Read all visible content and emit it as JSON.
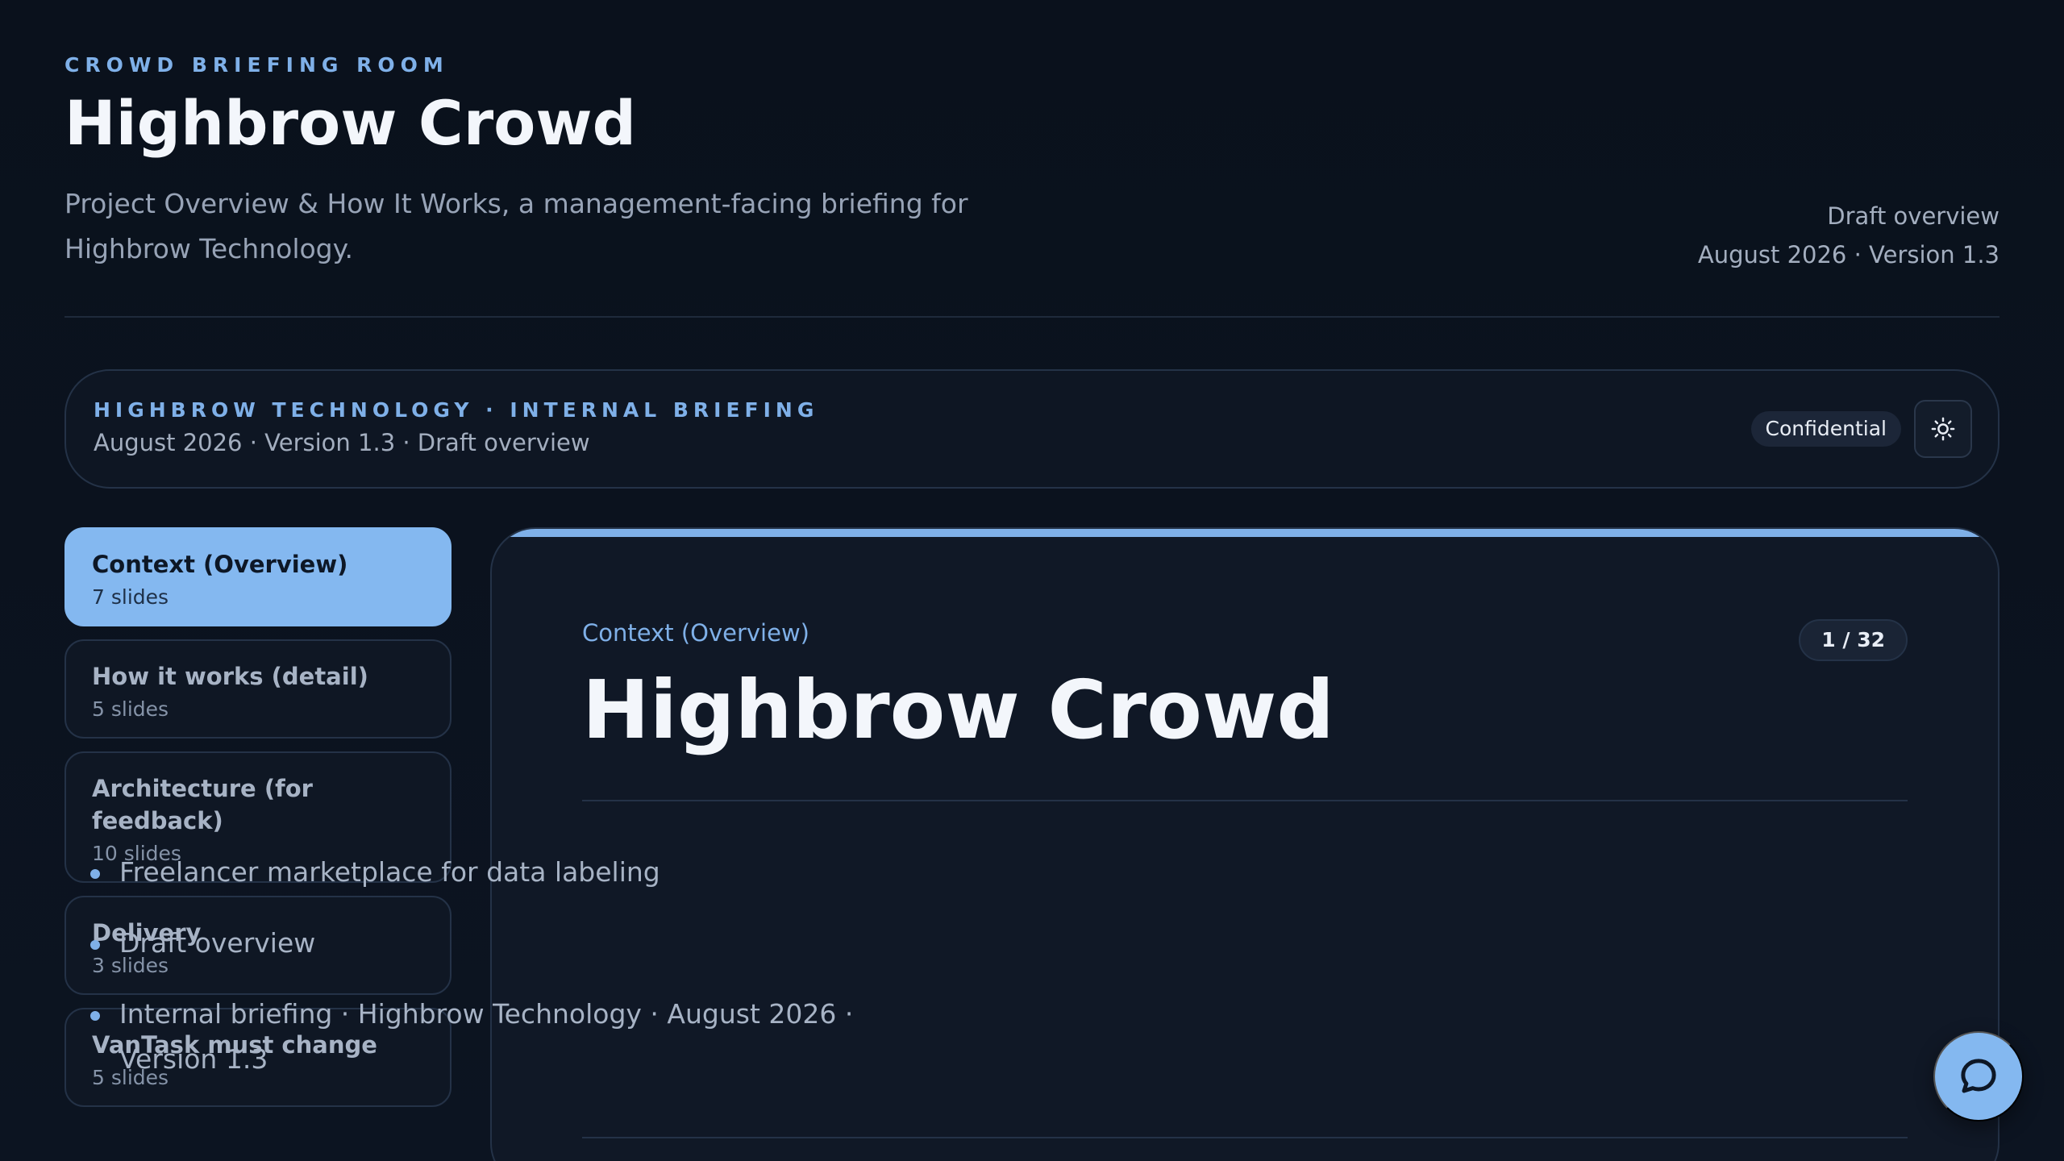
{
  "header": {
    "eyebrow": "CROWD BRIEFING ROOM",
    "title": "Highbrow Crowd",
    "subtitle": "Project Overview & How It Works, a management-facing briefing for Highbrow Technology.",
    "status": "Draft overview",
    "date_version": "August 2026 · Version 1.3"
  },
  "briefing_bar": {
    "eyebrow": "HIGHBROW TECHNOLOGY · INTERNAL BRIEFING",
    "meta": "August 2026 · Version 1.3 · Draft overview",
    "badge": "Confidential",
    "theme_icon": "sun-icon"
  },
  "sidebar": {
    "sections": [
      {
        "name": "Context (Overview)",
        "count": "7 slides",
        "active": true
      },
      {
        "name": "How it works (detail)",
        "count": "5 slides",
        "active": false
      },
      {
        "name": "Architecture (for feedback)",
        "count": "10 slides",
        "active": false
      },
      {
        "name": "Delivery",
        "count": "3 slides",
        "active": false
      },
      {
        "name": "VanTask must change",
        "count": "5 slides",
        "active": false
      }
    ]
  },
  "slide": {
    "section": "Context (Overview)",
    "counter": "1 / 32",
    "title": "Highbrow Crowd",
    "bullets": [
      "Freelancer marketplace for data labeling",
      "Draft overview",
      "Internal briefing · Highbrow Technology · August 2026 · Version 1.3"
    ]
  },
  "chat": {
    "icon": "chat-bubble-icon"
  },
  "colors": {
    "background": "#0b1220",
    "accent": "#7fb0e8",
    "active_section": "#84b8f0",
    "card": "#101826",
    "border": "#243247"
  }
}
